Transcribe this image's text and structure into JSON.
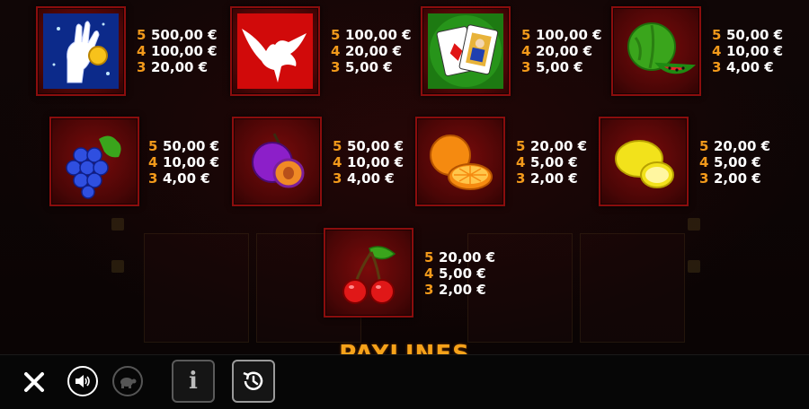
{
  "symbols": [
    {
      "name": "magic-hand",
      "pays": [
        {
          "count": "5",
          "amount": "500,00 €"
        },
        {
          "count": "4",
          "amount": "100,00 €"
        },
        {
          "count": "3",
          "amount": "20,00 €"
        }
      ]
    },
    {
      "name": "dove",
      "pays": [
        {
          "count": "5",
          "amount": "100,00 €"
        },
        {
          "count": "4",
          "amount": "20,00 €"
        },
        {
          "count": "3",
          "amount": "5,00 €"
        }
      ]
    },
    {
      "name": "cards",
      "pays": [
        {
          "count": "5",
          "amount": "100,00 €"
        },
        {
          "count": "4",
          "amount": "20,00 €"
        },
        {
          "count": "3",
          "amount": "5,00 €"
        }
      ]
    },
    {
      "name": "watermelon",
      "pays": [
        {
          "count": "5",
          "amount": "50,00 €"
        },
        {
          "count": "4",
          "amount": "10,00 €"
        },
        {
          "count": "3",
          "amount": "4,00 €"
        }
      ]
    },
    {
      "name": "grapes",
      "pays": [
        {
          "count": "5",
          "amount": "50,00 €"
        },
        {
          "count": "4",
          "amount": "10,00 €"
        },
        {
          "count": "3",
          "amount": "4,00 €"
        }
      ]
    },
    {
      "name": "plum",
      "pays": [
        {
          "count": "5",
          "amount": "50,00 €"
        },
        {
          "count": "4",
          "amount": "10,00 €"
        },
        {
          "count": "3",
          "amount": "4,00 €"
        }
      ]
    },
    {
      "name": "orange",
      "pays": [
        {
          "count": "5",
          "amount": "20,00 €"
        },
        {
          "count": "4",
          "amount": "5,00 €"
        },
        {
          "count": "3",
          "amount": "2,00 €"
        }
      ]
    },
    {
      "name": "lemon",
      "pays": [
        {
          "count": "5",
          "amount": "20,00 €"
        },
        {
          "count": "4",
          "amount": "5,00 €"
        },
        {
          "count": "3",
          "amount": "2,00 €"
        }
      ]
    },
    {
      "name": "cherries",
      "pays": [
        {
          "count": "5",
          "amount": "20,00 €"
        },
        {
          "count": "4",
          "amount": "5,00 €"
        },
        {
          "count": "3",
          "amount": "2,00 €"
        }
      ]
    }
  ],
  "section_title": "PAYLINES",
  "toolbar": {
    "close_icon": "close-icon",
    "sound_icon": "speaker-icon",
    "turbo_icon": "turtle-icon",
    "info_label": "i",
    "history_icon": "history-icon"
  },
  "colors": {
    "count": "#f39a1b",
    "amount": "#ffffff",
    "tile": "#7a0b0b",
    "title": "#f6a21a"
  }
}
